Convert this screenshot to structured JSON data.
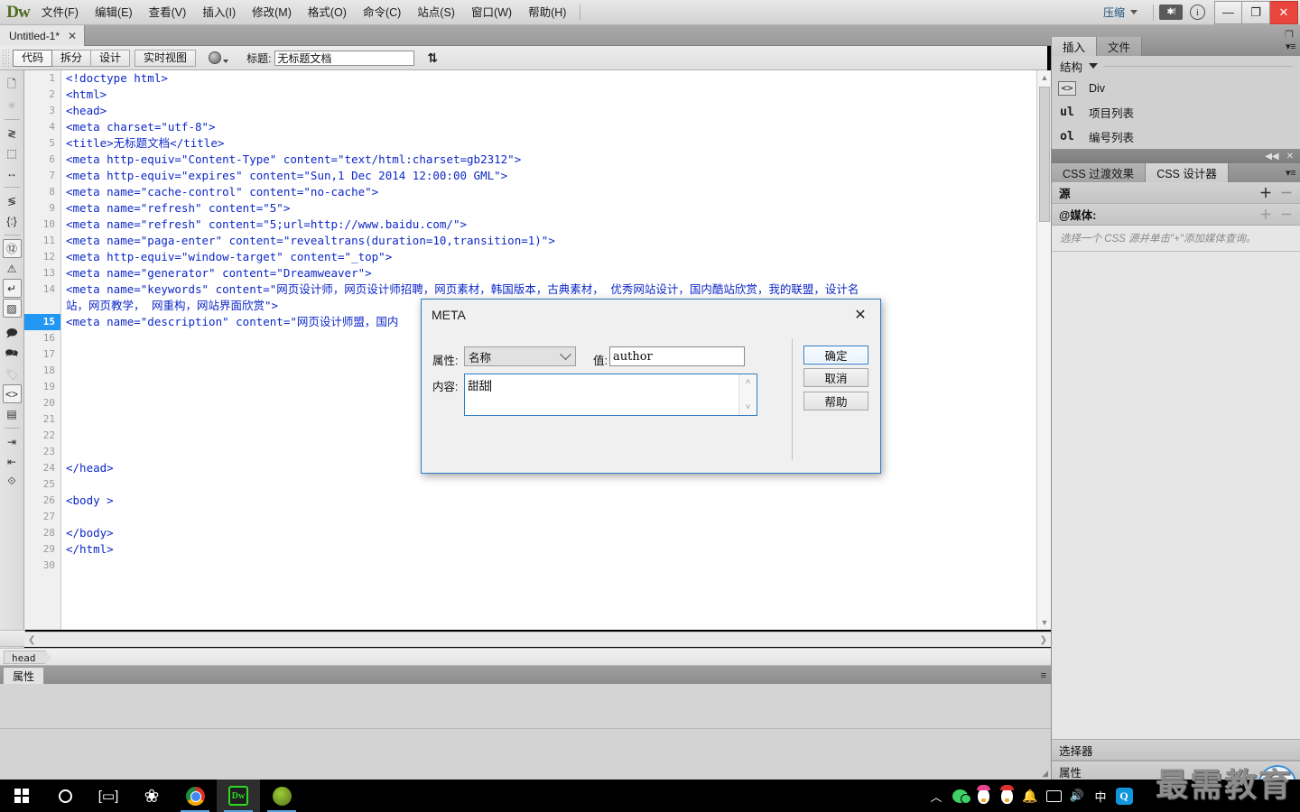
{
  "app": {
    "logo": "Dw",
    "workspace_label": "压缩",
    "menu": [
      {
        "label": "文件(F)"
      },
      {
        "label": "编辑(E)"
      },
      {
        "label": "查看(V)"
      },
      {
        "label": "插入(I)"
      },
      {
        "label": "修改(M)"
      },
      {
        "label": "格式(O)"
      },
      {
        "label": "命令(C)"
      },
      {
        "label": "站点(S)"
      },
      {
        "label": "窗口(W)"
      },
      {
        "label": "帮助(H)"
      }
    ],
    "window_controls": {
      "minimize": "—",
      "maximize": "❐",
      "close": "✕"
    },
    "alert_icon": "✱!",
    "info_icon": "i"
  },
  "doc_tab": {
    "title": "Untitled-1*",
    "close": "✕"
  },
  "viewbar": {
    "views": [
      {
        "label": "代码",
        "active": true
      },
      {
        "label": "拆分",
        "active": false
      },
      {
        "label": "设计",
        "active": false
      }
    ],
    "live_view": "实时视图",
    "title_label": "标题:",
    "title_value": "无标题文档",
    "globe_icon": "globe-icon",
    "filetransfer_icon": "file-transfer-icon"
  },
  "rail": {
    "icons": [
      "new-document-icon",
      "snowflake-icon",
      "collapse-full-tag-icon",
      "collapse-selection-icon",
      "expand-all-icon",
      "select-parent-tag-icon",
      "balance-braces-icon",
      "line-numbers-icon",
      "highlight-invalid-code-icon",
      "word-wrap-icon",
      "syntax-color-icon",
      "apply-comment-icon",
      "remove-comment-icon",
      "wrap-tag-icon",
      "recent-snippets-icon",
      "move-css-rules-icon",
      "indent-code-icon",
      "outdent-code-icon",
      "format-source-code-icon"
    ]
  },
  "editor": {
    "current_line": 15,
    "total_lines": 30,
    "lines": [
      {
        "n": 1,
        "text": "<!doctype html>"
      },
      {
        "n": 2,
        "text": "<html>"
      },
      {
        "n": 3,
        "text": "<head>"
      },
      {
        "n": 4,
        "text": "<meta charset=\"utf-8\">"
      },
      {
        "n": 5,
        "text": "<title>无标题文档</title>"
      },
      {
        "n": 6,
        "text": "<meta http-equiv=\"Content-Type\" content=\"text/html:charset=gb2312\">"
      },
      {
        "n": 7,
        "text": "<meta http-equiv=\"expires\" content=\"Sun,1 Dec 2014 12:00:00 GML\">"
      },
      {
        "n": 8,
        "text": "<meta name=\"cache-control\" content=\"no-cache\">"
      },
      {
        "n": 9,
        "text": "<meta name=\"refresh\" content=\"5\">"
      },
      {
        "n": 10,
        "text": "<meta name=\"refresh\" content=\"5;url=http://www.baidu.com/\">"
      },
      {
        "n": 11,
        "text": "<meta name=\"paga-enter\" content=\"revealtrans(duration=10,transition=1)\">"
      },
      {
        "n": 12,
        "text": "<meta http-equiv=\"window-target\" content=\"_top\">"
      },
      {
        "n": 13,
        "text": "<meta name=\"generator\" content=\"Dreamweaver\">"
      },
      {
        "n": 14,
        "text": "<meta name=\"keywords\" content=\"网页设计师，网页设计师招聘，网页素材，韩国版本，古典素材， 优秀网站设计，国内酷站欣赏，我的联盟，设计名"
      },
      {
        "n": 14,
        "wrap": true,
        "text": "站，网页教学， 网重构，网站界面欣赏\">"
      },
      {
        "n": 15,
        "text": "<meta name=\"description\" content=\"网页设计师盟，国内"
      },
      {
        "n": 16,
        "text": ""
      },
      {
        "n": 17,
        "text": ""
      },
      {
        "n": 18,
        "text": ""
      },
      {
        "n": 19,
        "text": ""
      },
      {
        "n": 20,
        "text": ""
      },
      {
        "n": 21,
        "text": ""
      },
      {
        "n": 22,
        "text": ""
      },
      {
        "n": 23,
        "text": ""
      },
      {
        "n": 24,
        "text": "</head>"
      },
      {
        "n": 25,
        "text": ""
      },
      {
        "n": 26,
        "text": "<body >"
      },
      {
        "n": 27,
        "text": ""
      },
      {
        "n": 28,
        "text": "</body>"
      },
      {
        "n": 29,
        "text": "</html>"
      },
      {
        "n": 30,
        "text": ""
      }
    ]
  },
  "status": {
    "breadcrumb_tag": "head",
    "properties_tab": "属性"
  },
  "dialog": {
    "title": "META",
    "close_icon": "✕",
    "attribute_label": "属性:",
    "attribute_value": "名称",
    "value_label": "值:",
    "value_text": "author",
    "content_label": "内容:",
    "content_text": "甜甜",
    "buttons": [
      {
        "label": "确定",
        "primary": true
      },
      {
        "label": "取消",
        "primary": false
      },
      {
        "label": "帮助",
        "primary": false
      }
    ],
    "accent_color": "#2b7cc4"
  },
  "right_panel": {
    "tabs": [
      {
        "label": "插入",
        "active": true
      },
      {
        "label": "文件",
        "active": false
      }
    ],
    "structure_label": "结构",
    "insert_items": [
      {
        "icon": "code-div-icon",
        "icon_text": "<>",
        "label": "Div"
      },
      {
        "icon": "unordered-list-icon",
        "icon_text": "ul",
        "label": "项目列表"
      },
      {
        "icon": "ordered-list-icon",
        "icon_text": "ol",
        "label": "编号列表"
      }
    ],
    "css_tabs": [
      {
        "label": "CSS 过渡效果",
        "active": false
      },
      {
        "label": "CSS 设计器",
        "active": true
      }
    ],
    "sources_label": "源",
    "media_label": "@媒体:",
    "media_hint": "选择一个 CSS 源并单击\"+\"添加媒体查询。",
    "selectors_label": "选择器",
    "properties_label": "属性",
    "collapse_icon": "◀◀",
    "close_icon": "✕"
  },
  "watermark": {
    "text": "最需教育"
  },
  "taskbar": {
    "items": [
      {
        "icon": "windows-start-icon",
        "name": "start-button"
      },
      {
        "icon": "cortana-search-icon",
        "name": "search-button"
      },
      {
        "icon": "task-view-icon",
        "name": "task-view-button"
      },
      {
        "icon": "fan-app-icon",
        "name": "app-fan"
      },
      {
        "icon": "chrome-icon",
        "name": "app-chrome"
      },
      {
        "icon": "dreamweaver-icon",
        "name": "app-dreamweaver"
      },
      {
        "icon": "watermelon-icon",
        "name": "app-watermelon"
      }
    ],
    "tray": [
      {
        "icon": "chevron-up-icon"
      },
      {
        "icon": "wechat-icon"
      },
      {
        "icon": "qq-penguin-pink-icon"
      },
      {
        "icon": "qq-penguin-red-icon"
      },
      {
        "icon": "notification-bell-icon"
      },
      {
        "icon": "network-monitor-icon"
      },
      {
        "icon": "volume-icon"
      },
      {
        "icon": "ime-chinese-icon",
        "label": "中"
      },
      {
        "icon": "qq-browser-icon",
        "label": "Q"
      }
    ]
  }
}
